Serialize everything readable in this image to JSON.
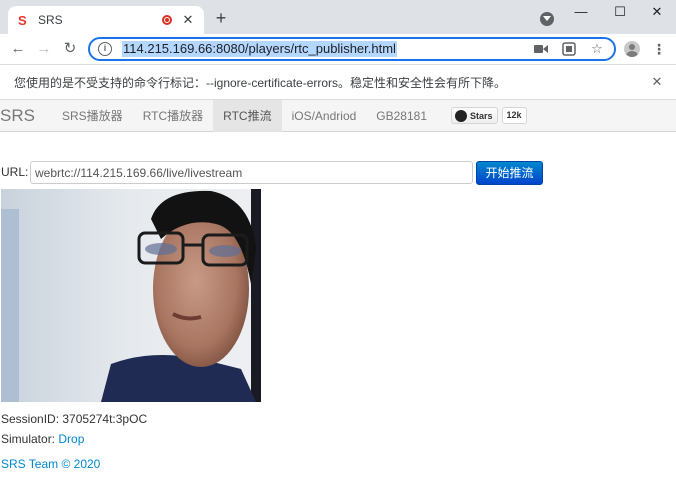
{
  "browser": {
    "tab_title": "SRS",
    "url": "114.215.169.66:8080/players/rtc_publisher.html"
  },
  "infobar": {
    "message": "您使用的是不受支持的命令行标记：--ignore-certificate-errors。稳定性和安全性会有所下降。"
  },
  "navbar": {
    "brand": "SRS",
    "items": [
      {
        "label": "SRS播放器"
      },
      {
        "label": "RTC播放器"
      },
      {
        "label": "RTC推流"
      },
      {
        "label": "iOS/Andriod"
      },
      {
        "label": "GB28181"
      }
    ],
    "github": {
      "label": "Stars",
      "count": "12k"
    }
  },
  "form": {
    "url_label": "URL:",
    "url_value": "webrtc://114.215.169.66/live/livestream",
    "publish_label": "开始推流"
  },
  "status": {
    "session_label": "SessionID:",
    "session_id": "3705274t:3pOC",
    "simulator_label": "Simulator:",
    "simulator_link": "Drop"
  },
  "footer": {
    "text": "SRS Team © 2020"
  },
  "colors": {
    "accent": "#1a73e8",
    "link": "#0088cc",
    "record": "#d93025"
  }
}
